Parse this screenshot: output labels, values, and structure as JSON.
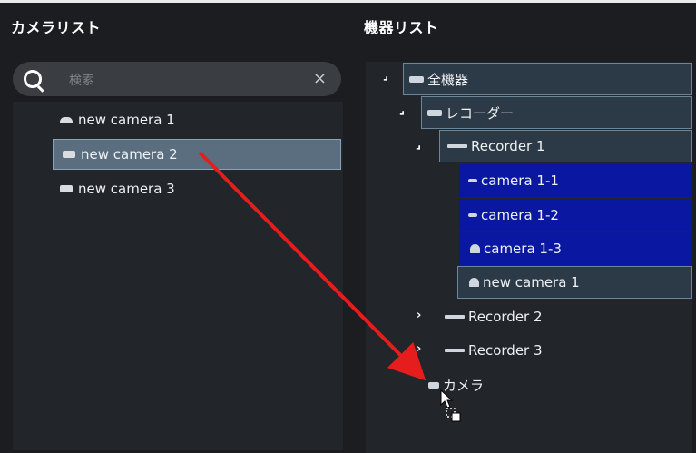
{
  "left_panel": {
    "title": "カメラリスト",
    "search": {
      "placeholder": "検索",
      "clear": "×"
    },
    "cameras": [
      {
        "label": "new camera 1",
        "icon": "dome-camera-icon",
        "selected": false
      },
      {
        "label": "new camera 2",
        "icon": "box-camera-icon",
        "selected": true
      },
      {
        "label": "new camera 3",
        "icon": "box-camera-icon",
        "selected": false
      }
    ]
  },
  "right_panel": {
    "title": "機器リスト",
    "tree": {
      "root": {
        "label": "全機器",
        "expand_glyph": "⌟"
      },
      "recorder_group": {
        "label": "レコーダー",
        "expand_glyph": "⌟"
      },
      "recorders": [
        {
          "label": "Recorder 1",
          "expand_glyph": "⌟",
          "cameras": [
            {
              "label": "camera 1-1",
              "icon": "bullet-camera-icon"
            },
            {
              "label": "camera 1-2",
              "icon": "bullet-camera-icon"
            },
            {
              "label": "camera 1-3",
              "icon": "dome-camera-icon"
            },
            {
              "label": "new camera 1",
              "icon": "dome-camera-icon"
            }
          ]
        },
        {
          "label": "Recorder 2",
          "expand_glyph": "›"
        },
        {
          "label": "Recorder 3",
          "expand_glyph": "›"
        }
      ],
      "camera_group": {
        "label": "カメラ"
      }
    }
  },
  "colors": {
    "background": "#1b1d20",
    "selection": "#5a6e80",
    "highlight_blue": "#0a17a0",
    "drag_arrow": "#e51d1d"
  }
}
